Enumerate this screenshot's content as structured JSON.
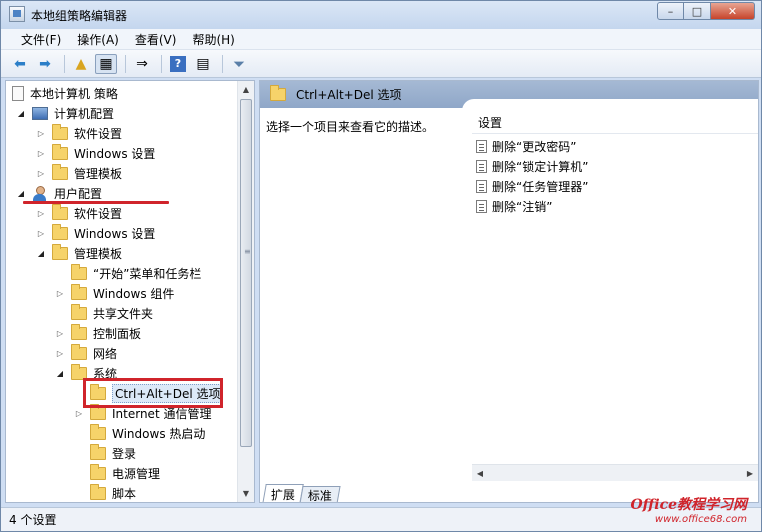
{
  "window": {
    "title": "本地组策略编辑器",
    "minimize_glyph": "–",
    "maximize_glyph": "□",
    "close_glyph": "✕"
  },
  "menu": [
    "文件(F)",
    "操作(A)",
    "查看(V)",
    "帮助(H)"
  ],
  "toolbar": {
    "icons": [
      "back-arrow-icon",
      "forward-arrow-icon",
      "folder-up-icon",
      "show-hide-tree-icon",
      "export-list-icon",
      "help-icon",
      "properties-icon",
      "filter-icon"
    ]
  },
  "tree": {
    "items": [
      {
        "label": "本地计算机 策略",
        "icon": "document-icon",
        "expander": ""
      },
      {
        "label": "计算机配置",
        "icon": "computer-icon",
        "expander": "open"
      },
      {
        "label": "软件设置",
        "icon": "folder-icon",
        "expander": "closed"
      },
      {
        "label": "Windows 设置",
        "icon": "folder-icon",
        "expander": "closed"
      },
      {
        "label": "管理模板",
        "icon": "folder-icon",
        "expander": "closed"
      },
      {
        "label": "用户配置",
        "icon": "user-icon",
        "expander": "open"
      },
      {
        "label": "软件设置",
        "icon": "folder-icon",
        "expander": "closed"
      },
      {
        "label": "Windows 设置",
        "icon": "folder-icon",
        "expander": "closed"
      },
      {
        "label": "管理模板",
        "icon": "folder-icon",
        "expander": "open"
      },
      {
        "label": "“开始”菜单和任务栏",
        "icon": "folder-icon",
        "expander": ""
      },
      {
        "label": "Windows 组件",
        "icon": "folder-icon",
        "expander": "closed"
      },
      {
        "label": "共享文件夹",
        "icon": "folder-icon",
        "expander": ""
      },
      {
        "label": "控制面板",
        "icon": "folder-icon",
        "expander": "closed"
      },
      {
        "label": "网络",
        "icon": "folder-icon",
        "expander": "closed"
      },
      {
        "label": "系统",
        "icon": "folder-icon",
        "expander": "open"
      },
      {
        "label": "Ctrl+Alt+Del 选项",
        "icon": "folder-icon",
        "expander": "",
        "selected": true
      },
      {
        "label": "Internet 通信管理",
        "icon": "folder-icon",
        "expander": "closed"
      },
      {
        "label": "Windows 热启动",
        "icon": "folder-icon",
        "expander": ""
      },
      {
        "label": "登录",
        "icon": "folder-icon",
        "expander": ""
      },
      {
        "label": "电源管理",
        "icon": "folder-icon",
        "expander": ""
      },
      {
        "label": "脚本",
        "icon": "folder-icon",
        "expander": ""
      }
    ]
  },
  "detail": {
    "header": "Ctrl+Alt+Del 选项",
    "description": "选择一个项目来查看它的描述。",
    "column_header": "设置",
    "settings": [
      "删除“更改密码”",
      "删除“锁定计算机”",
      "删除“任务管理器”",
      "删除“注销”"
    ],
    "tabs": [
      "扩展",
      "标准"
    ],
    "active_tab": "扩展"
  },
  "status": "4 个设置",
  "watermark": {
    "main": "Office教程学习网",
    "sub": "www.office68.com"
  },
  "colors": {
    "annotation_red": "#d0242b",
    "header_blue": "#9bb1cf"
  }
}
